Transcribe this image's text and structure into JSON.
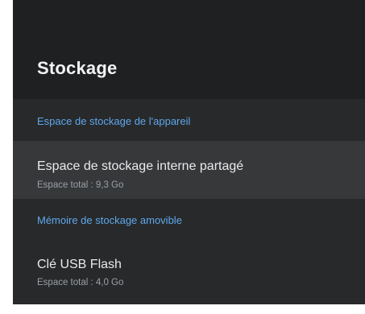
{
  "screen": {
    "title": "Stockage"
  },
  "sections": [
    {
      "header": "Espace de stockage de l'appareil",
      "items": [
        {
          "title": "Espace de stockage interne partagé",
          "subtitle": "Espace total : 9,3 Go"
        }
      ]
    },
    {
      "header": "Mémoire de stockage amovible",
      "items": [
        {
          "title": "Clé USB Flash",
          "subtitle": "Espace total : 4,0 Go"
        }
      ]
    }
  ],
  "colors": {
    "panel_background": "#1f2021",
    "list_background": "#28292a",
    "focused_item_background": "#36383a",
    "section_header_text": "#5ea8ee",
    "primary_text": "#e8eaed",
    "secondary_text": "#9aa0a6"
  }
}
